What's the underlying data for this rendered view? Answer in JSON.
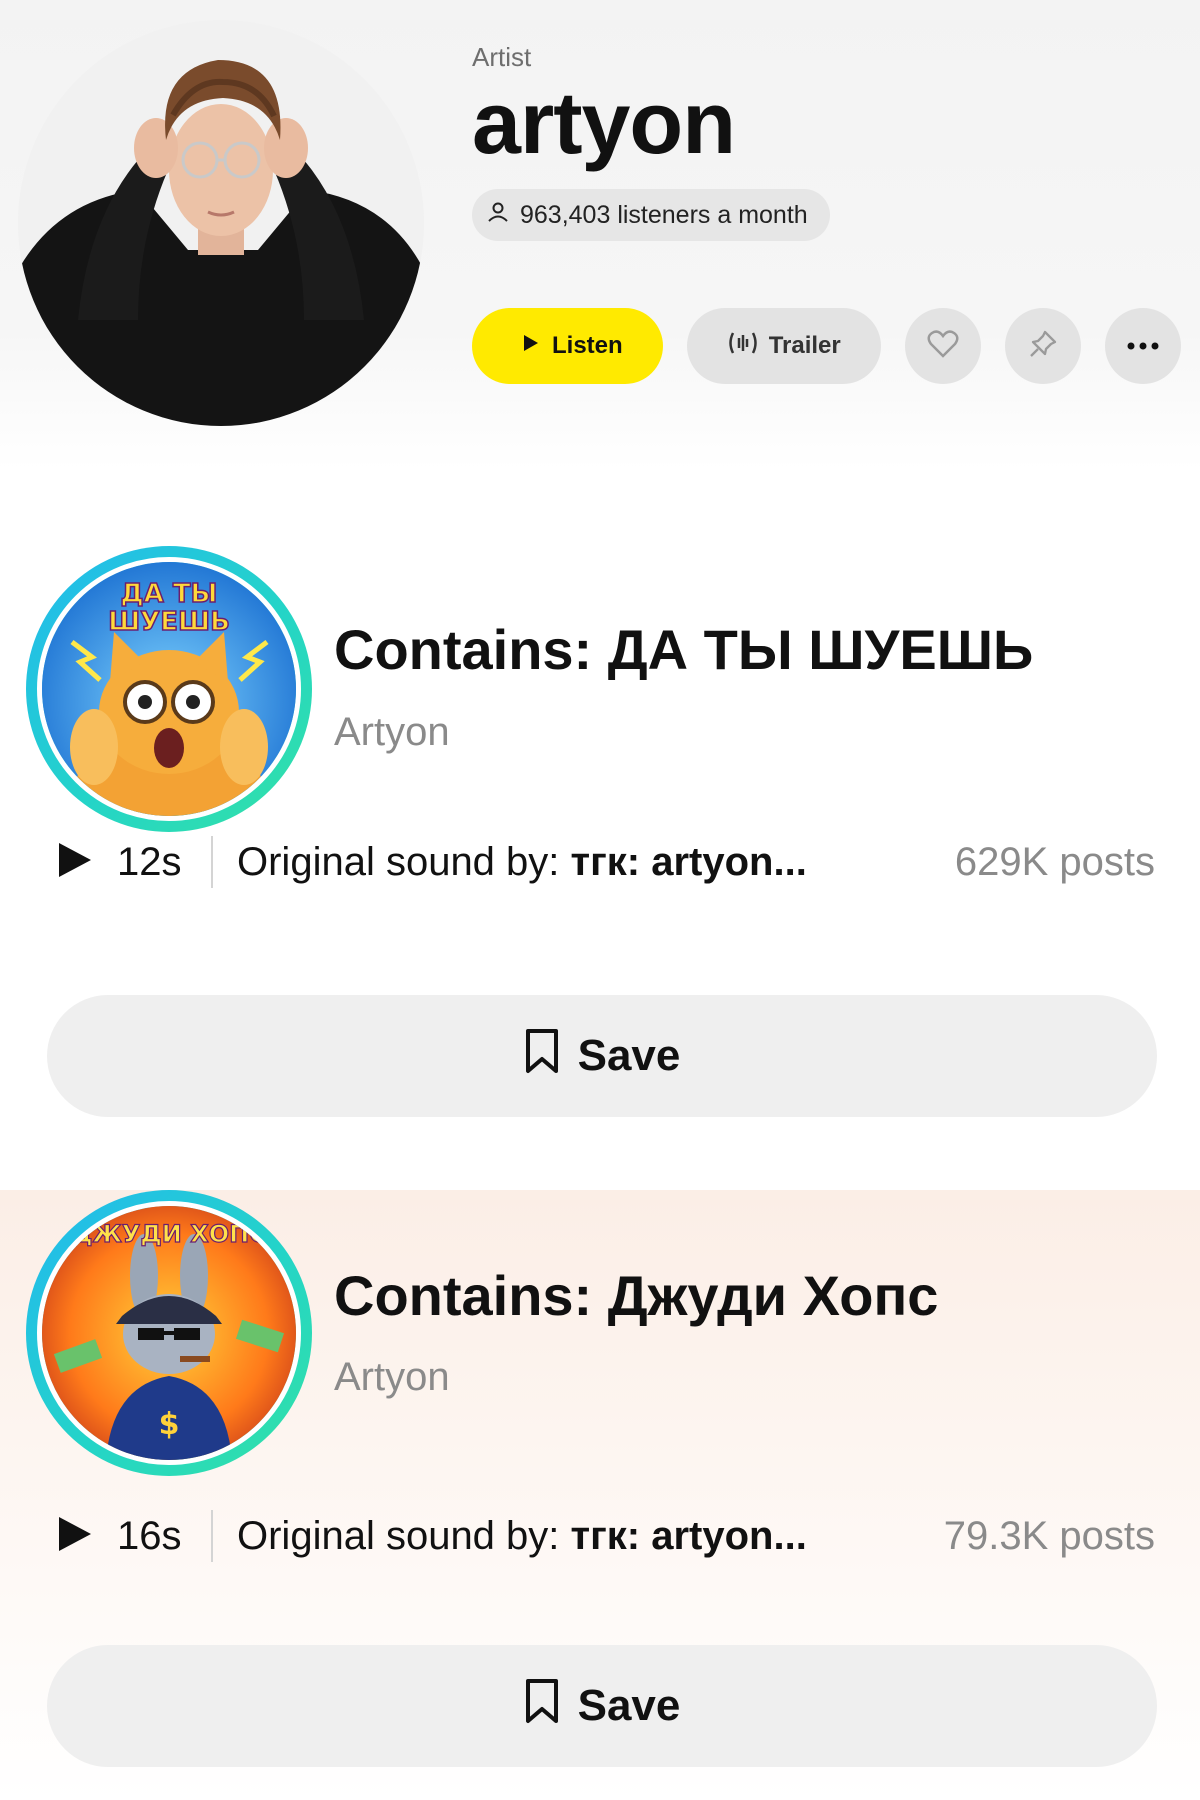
{
  "artist": {
    "type_label": "Artist",
    "name": "artyon",
    "listeners": "963,403 listeners a month",
    "buttons": {
      "listen": "Listen",
      "trailer": "Trailer"
    },
    "icons": [
      "user-icon",
      "play-icon",
      "waveform-icon",
      "heart-icon",
      "pin-icon",
      "more-icon"
    ]
  },
  "sounds": [
    {
      "title": "Contains: ДА ТЫ ШУЕШЬ",
      "artist": "Artyon",
      "duration": "12s",
      "original_prefix": "Original sound by: ",
      "original_author": "тгк: artyon...",
      "posts": "629K posts",
      "save_label": "Save",
      "cover_text": "ДА ТЫ ШУЕШЬ"
    },
    {
      "title": "Contains: Джуди Хопс",
      "artist": "Artyon",
      "duration": "16s",
      "original_prefix": "Original sound by: ",
      "original_author": "тгк: artyon...",
      "posts": "79.3K posts",
      "save_label": "Save",
      "cover_text": "ДЖУДИ ХОПС"
    }
  ],
  "colors": {
    "listen_button": "#ffea00",
    "cover_ring_start": "#22b8f0",
    "cover_ring_end": "#33e2a4",
    "muted_text": "#8a8a8a"
  }
}
